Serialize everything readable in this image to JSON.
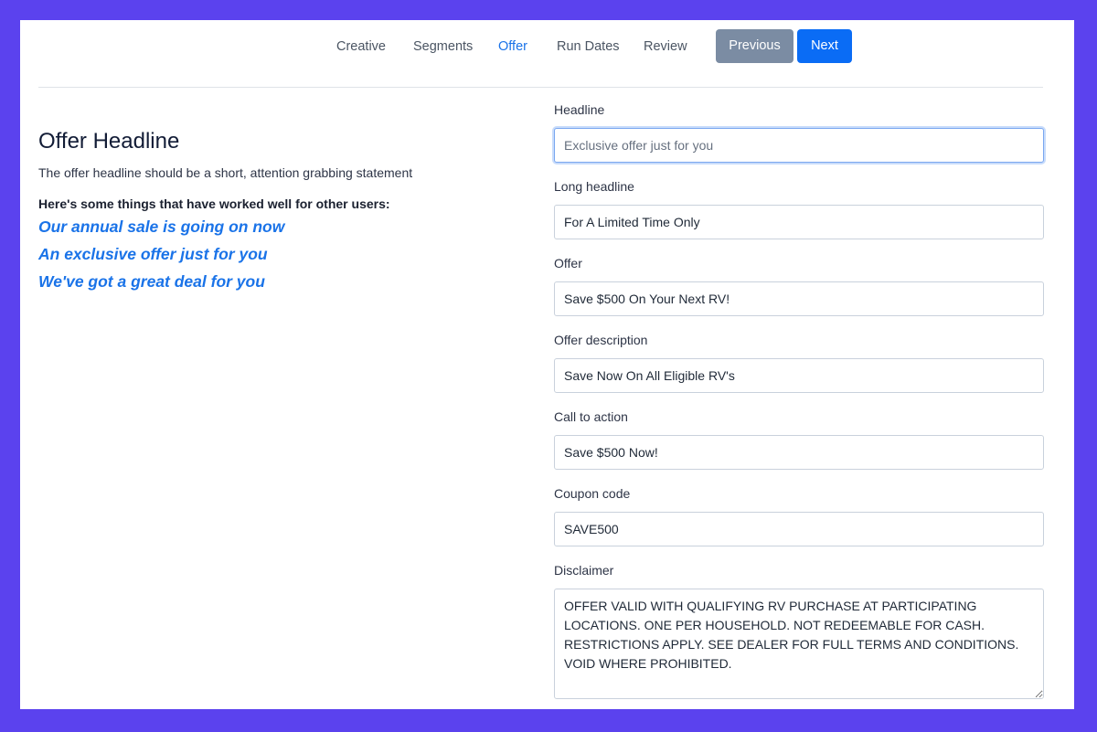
{
  "nav": {
    "tabs": [
      {
        "label": "Creative"
      },
      {
        "label": "Segments"
      },
      {
        "label": "Offer",
        "active": true
      },
      {
        "label": "Run Dates"
      },
      {
        "label": "Review"
      }
    ],
    "previous_label": "Previous",
    "next_label": "Next"
  },
  "colors": {
    "background": "#5b42ee",
    "accent": "#1a73e8",
    "next_button": "#0a6cf5",
    "previous_button": "#7b8ca3"
  },
  "help": {
    "title": "Offer Headline",
    "description": "The offer headline should be a short, attention grabbing statement",
    "suggestions_intro": "Here's some things that have worked well for other users:",
    "suggestions": [
      "Our annual sale is going on now",
      "An exclusive offer just for you",
      "We've got a great deal for you"
    ]
  },
  "form": {
    "headline": {
      "label": "Headline",
      "value": "",
      "placeholder": "Exclusive offer just for you"
    },
    "long_headline": {
      "label": "Long headline",
      "value": "For A Limited Time Only"
    },
    "offer": {
      "label": "Offer",
      "value": "Save $500 On Your Next RV!"
    },
    "offer_description": {
      "label": "Offer description",
      "value": "Save Now On All Eligible RV's"
    },
    "call_to_action": {
      "label": "Call to action",
      "value": "Save $500 Now!"
    },
    "coupon_code": {
      "label": "Coupon code",
      "value": "SAVE500"
    },
    "disclaimer": {
      "label": "Disclaimer",
      "value": "OFFER VALID WITH QUALIFYING RV PURCHASE AT PARTICIPATING LOCATIONS. ONE PER HOUSEHOLD. NOT REDEEMABLE FOR CASH. RESTRICTIONS APPLY. SEE DEALER FOR FULL TERMS AND CONDITIONS. VOID WHERE PROHIBITED."
    }
  }
}
